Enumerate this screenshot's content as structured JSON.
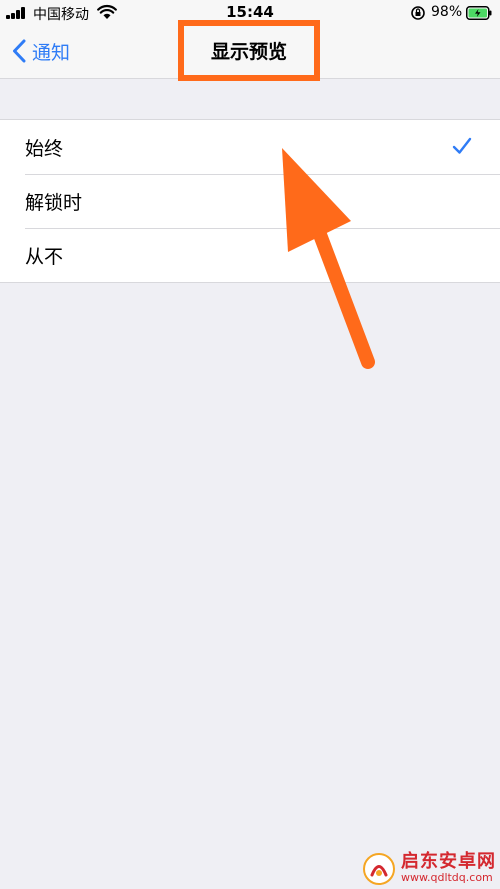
{
  "status_bar": {
    "carrier": "中国移动",
    "time": "15:44",
    "battery_percent": "98%"
  },
  "nav": {
    "back_label": "通知",
    "title": "显示预览"
  },
  "options": [
    {
      "label": "始终",
      "selected": true
    },
    {
      "label": "解锁时",
      "selected": false
    },
    {
      "label": "从不",
      "selected": false
    }
  ],
  "colors": {
    "accent": "#2f7cf6",
    "annotation": "#ff6a1a",
    "background": "#efeff4"
  },
  "watermark": {
    "name": "启东安卓网",
    "url": "www.qdltdq.com"
  }
}
